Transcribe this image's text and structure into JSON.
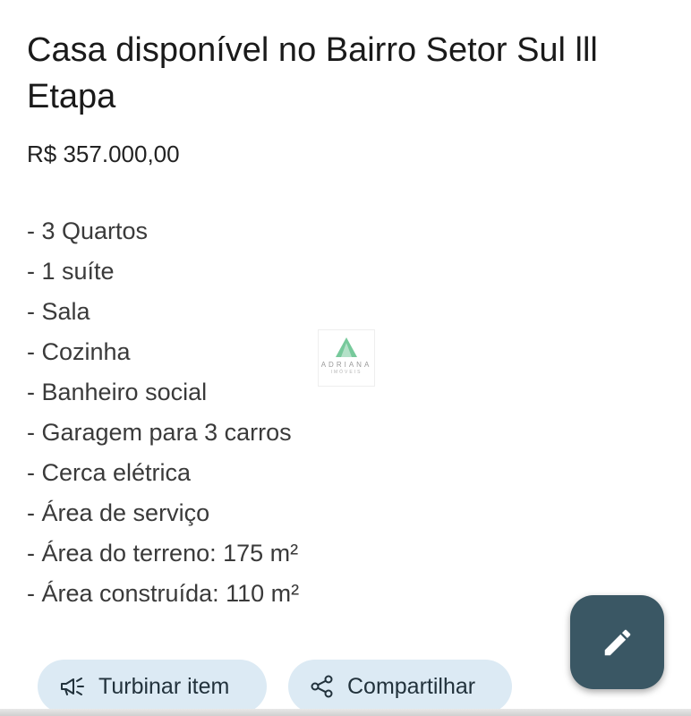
{
  "listing": {
    "title": "Casa disponível no Bairro Setor Sul lll Etapa",
    "price": "R$ 357.000,00",
    "features": [
      "- 3 Quartos",
      "- 1 suíte",
      "- Sala",
      "- Cozinha",
      "- Banheiro social",
      "- Garagem para 3 carros",
      "- Cerca elétrica",
      "- Área de serviço",
      "- Área do terreno: 175 m²",
      "- Área construída: 110 m²"
    ]
  },
  "watermark": {
    "name": "ADRIANA",
    "subtitle": "IMÓVEIS",
    "color": "#5fbf8a"
  },
  "actions": {
    "boost_label": "Turbinar item",
    "boost_icon": "megaphone-icon",
    "share_label": "Compartilhar",
    "share_icon": "share-icon",
    "edit_icon": "pencil-icon"
  },
  "colors": {
    "fab_background": "#3a5764",
    "chip_background": "#dceaf4",
    "text_primary": "#1a1a1a"
  }
}
